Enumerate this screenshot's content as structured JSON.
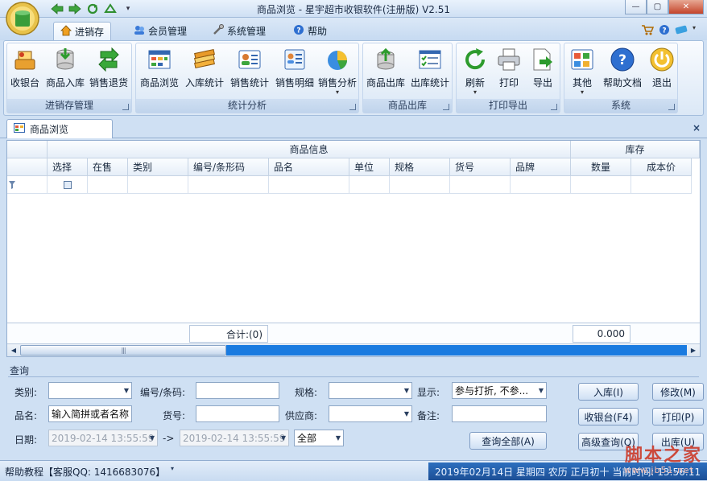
{
  "window": {
    "title": "商品浏览 - 星宇超市收银软件(注册版) V2.51",
    "min_glyph": "—",
    "max_glyph": "▢",
    "close_glyph": "✕"
  },
  "ribbon_tabs": [
    {
      "label": "进销存",
      "icon": "home-icon",
      "active": true
    },
    {
      "label": "会员管理",
      "icon": "members-icon",
      "active": false
    },
    {
      "label": "系统管理",
      "icon": "tools-icon",
      "active": false
    },
    {
      "label": "帮助",
      "icon": "help-icon",
      "active": false
    }
  ],
  "ribbon_groups": [
    {
      "label": "进销存管理",
      "buttons": [
        "收银台",
        "商品入库",
        "销售退货"
      ]
    },
    {
      "label": "统计分析",
      "buttons": [
        "商品浏览",
        "入库统计",
        "销售统计",
        "销售明细",
        "销售分析"
      ]
    },
    {
      "label": "商品出库",
      "buttons": [
        "商品出库",
        "出库统计"
      ]
    },
    {
      "label": "打印导出",
      "buttons": [
        "刷新",
        "打印",
        "导出"
      ]
    },
    {
      "label": "系统",
      "buttons": [
        "其他",
        "帮助文档",
        "退出"
      ]
    }
  ],
  "doc_tab": {
    "label": "商品浏览",
    "close_glyph": "×"
  },
  "grid": {
    "band_info": "商品信息",
    "band_stock": "库存",
    "columns": [
      "选择",
      "在售",
      "类别",
      "编号/条形码",
      "品名",
      "单位",
      "规格",
      "货号",
      "品牌",
      "数量",
      "成本价"
    ],
    "total_label": "合计:(0)",
    "total_qty": "0.000",
    "scroll_grip": "|||"
  },
  "query": {
    "title": "查询",
    "category_label": "类别:",
    "code_label": "编号/条码:",
    "spec_label": "规格:",
    "display_label": "显示:",
    "display_value": "参与打折, 不参...",
    "name_label": "品名:",
    "name_placeholder": "输入简拼或者名称",
    "itemno_label": "货号:",
    "supplier_label": "供应商:",
    "remark_label": "备注:",
    "date_label": "日期:",
    "date_from": "2019-02-14 13:55:59",
    "date_arrow": "->",
    "date_to": "2019-02-14 13:55:59",
    "range_value": "全部",
    "btn_query_all": "查询全部(A)",
    "btn_instock": "入库(I)",
    "btn_modify": "修改(M)",
    "btn_cashier": "收银台(F4)",
    "btn_print": "打印(P)",
    "btn_advanced": "高级查询(Q)",
    "btn_outstock": "出库(U)"
  },
  "status": {
    "help": "帮助教程【客服QQ: 1416683076】",
    "date": "2019年02月14日 星期四 农历 正月初十 当前时间: 13:56:11"
  },
  "watermark": {
    "main": "脚本之家",
    "sub": "www.jb51.net"
  },
  "colors": {
    "accent": "#1a7be0",
    "ribbon_bg": "#dbe8f6",
    "status_dark": "#1c4f96"
  }
}
